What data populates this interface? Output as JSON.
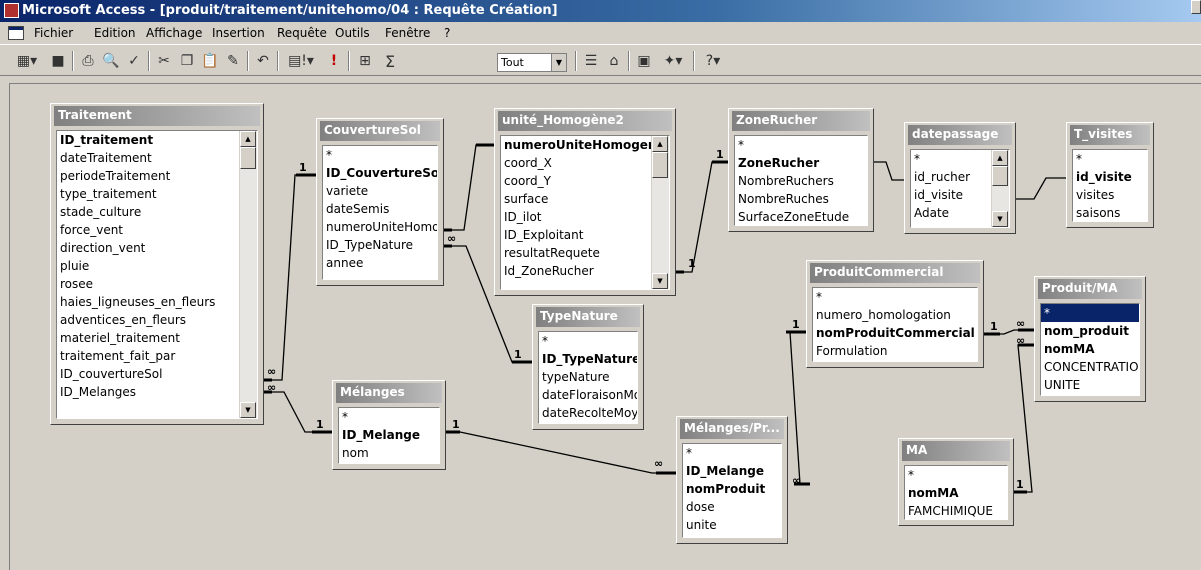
{
  "window": {
    "title": "Microsoft Access - [produit/traitement/unitehomo/04 : Requête Création]"
  },
  "menu": [
    "Fichier",
    "Edition",
    "Affichage",
    "Insertion",
    "Requête",
    "Outils",
    "Fenêtre",
    "?"
  ],
  "toolbar": {
    "query_type_combo": "Tout",
    "sigma": "Σ"
  },
  "tables": {
    "traitement": {
      "name": "Traitement",
      "fields": [
        "ID_traitement",
        "dateTraitement",
        "periodeTraitement",
        "type_traitement",
        "stade_culture",
        "force_vent",
        "direction_vent",
        "pluie",
        "rosee",
        "haies_ligneuses_en_fleurs",
        "adventices_en_fleurs",
        "materiel_traitement",
        "traitement_fait_par",
        "ID_couvertureSol",
        "ID_Melanges"
      ]
    },
    "couverture_sol": {
      "name": "CouvertureSol",
      "fields": [
        "*",
        "ID_CouvertureSol",
        "variete",
        "dateSemis",
        "numeroUniteHomoge",
        "ID_TypeNature",
        "annee"
      ]
    },
    "unite_homogene": {
      "name": "unité_Homogène2",
      "fields": [
        "numeroUniteHomogene",
        "coord_X",
        "coord_Y",
        "surface",
        "ID_ilot",
        "ID_Exploitant",
        "resultatRequete",
        "Id_ZoneRucher"
      ]
    },
    "zone_rucher": {
      "name": "ZoneRucher",
      "fields": [
        "*",
        "ZoneRucher",
        "NombreRuchers",
        "NombreRuches",
        "SurfaceZoneEtude"
      ]
    },
    "datepassage": {
      "name": "datepassage",
      "fields": [
        "*",
        "id_rucher",
        "id_visite",
        "Adate"
      ]
    },
    "t_visites": {
      "name": "T_visites",
      "fields": [
        "*",
        "id_visite",
        "visites",
        "saisons"
      ]
    },
    "type_nature": {
      "name": "TypeNature",
      "fields": [
        "*",
        "ID_TypeNature",
        "typeNature",
        "dateFloraisonMoy",
        "dateRecolteMoye"
      ]
    },
    "melanges": {
      "name": "Mélanges",
      "fields": [
        "*",
        "ID_Melange",
        "nom"
      ]
    },
    "produit_commercial": {
      "name": "ProduitCommercial",
      "fields": [
        "*",
        "numero_homologation",
        "nomProduitCommercial",
        "Formulation"
      ]
    },
    "produit_ma": {
      "name": "Produit/MA",
      "fields": [
        "*",
        "nom_produit",
        "nomMA",
        "CONCENTRATION",
        "UNITE"
      ]
    },
    "melanges_pr": {
      "name": "Mélanges/Pr...",
      "fields": [
        "*",
        "ID_Melange",
        "nomProduit",
        "dose",
        "unite"
      ]
    },
    "ma": {
      "name": "MA",
      "fields": [
        "*",
        "nomMA",
        "FAMCHIMIQUE"
      ]
    }
  },
  "relations": {
    "one": "1",
    "many": "∞"
  }
}
